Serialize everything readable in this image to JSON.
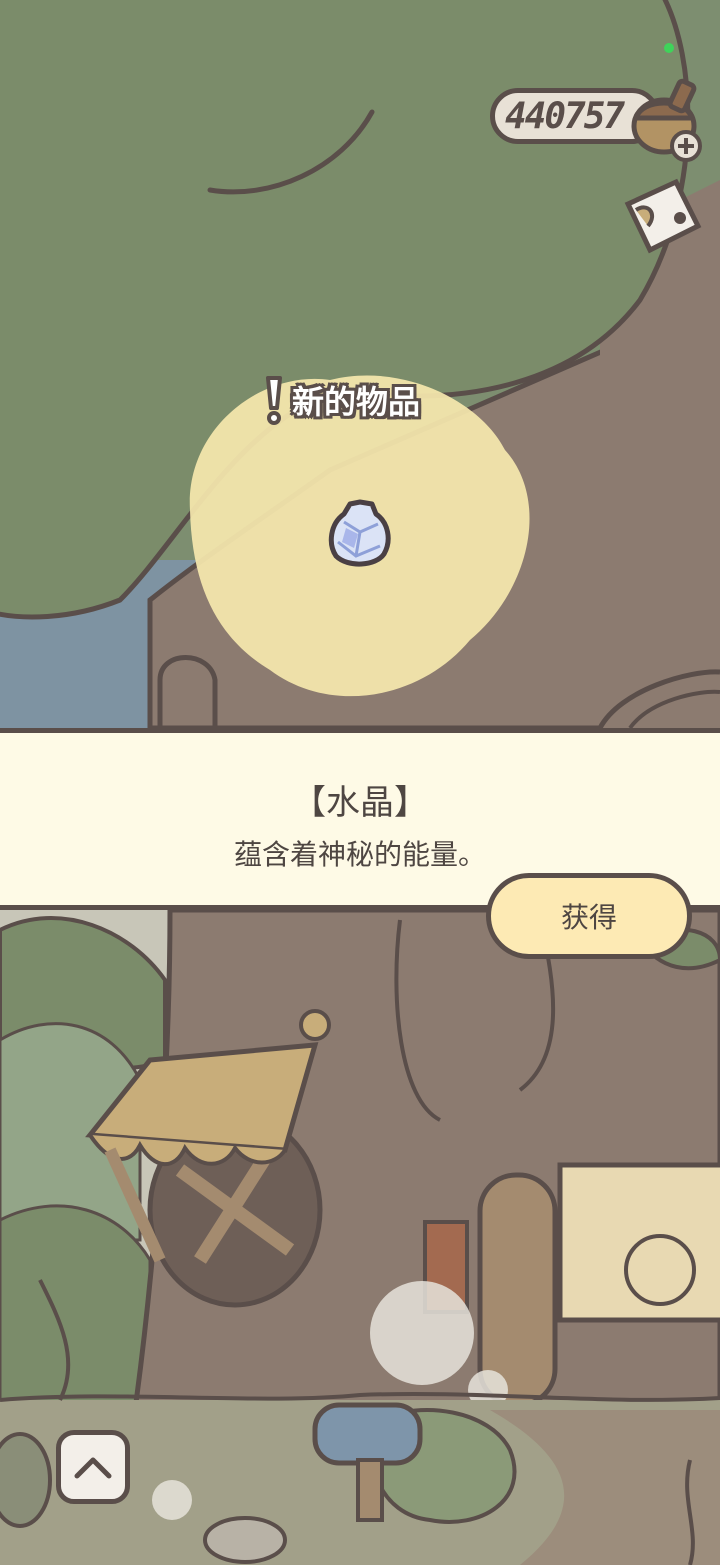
{
  "hud": {
    "acorn_count": "440757"
  },
  "notification": {
    "new_item_label": "新的物品"
  },
  "item_panel": {
    "name": "【水晶】",
    "description": "蕴含着神秘的能量。"
  },
  "actions": {
    "obtain_label": "获得"
  },
  "colors": {
    "outline": "#5a4e4a",
    "panel_bg": "#fefae6",
    "button_bg": "#fdeab4",
    "tree_canopy": "#7b8c6a",
    "trunk": "#8c7b70"
  }
}
